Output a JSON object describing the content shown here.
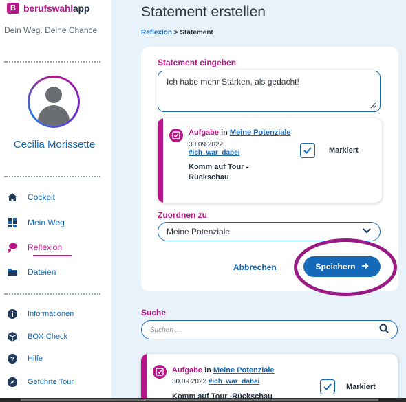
{
  "brand": {
    "logo_letter": "B",
    "name_part1": "berufswahl",
    "name_part2": "app",
    "tagline": "Dein Weg. Deine Chance"
  },
  "user": {
    "name": "Cecilia Morissette"
  },
  "nav": {
    "main": [
      {
        "label": "Cockpit",
        "icon": "home-icon"
      },
      {
        "label": "Mein Weg",
        "icon": "path-icon"
      },
      {
        "label": "Reflexion",
        "icon": "thought-bubble-icon",
        "active": true
      },
      {
        "label": "Dateien",
        "icon": "folder-icon"
      }
    ],
    "secondary": [
      {
        "label": "Informationen",
        "icon": "info-icon"
      },
      {
        "label": "BOX-Check",
        "icon": "box-icon"
      },
      {
        "label": "Hilfe",
        "icon": "help-icon"
      },
      {
        "label": "Geführte Tour",
        "icon": "compass-icon"
      }
    ]
  },
  "page": {
    "title": "Statement erstellen",
    "breadcrumb": {
      "parent": "Reflexion",
      "separator": ">",
      "current": "Statement"
    }
  },
  "form": {
    "statement_label": "Statement eingeben",
    "statement_value": "Ich habe mehr Stärken, als gedacht!",
    "task": {
      "prefix": "Aufgabe",
      "in_word": "in",
      "category": "Meine Potenziale",
      "date": "30.09.2022",
      "tag": "#ich_war_dabei",
      "title": "Komm auf Tour -Rückschau",
      "marked_label": "Markiert",
      "marked": true
    },
    "assign_label": "Zuordnen zu",
    "assign_value": "Meine Potenziale",
    "cancel_label": "Abbrechen",
    "save_label": "Speichern"
  },
  "search": {
    "label": "Suche",
    "placeholder": "Suchen ..."
  },
  "result": {
    "prefix": "Aufgabe",
    "in_word": "in",
    "category": "Meine Potenziale",
    "date": "30.09.2022",
    "tag": "#ich_war_dabei",
    "title": "Komm auf Tour -Rückschau",
    "marked_label": "Markiert"
  },
  "colors": {
    "accent_pink": "#b8148a",
    "primary_blue": "#1468b8",
    "background": "#e8f2fa"
  }
}
